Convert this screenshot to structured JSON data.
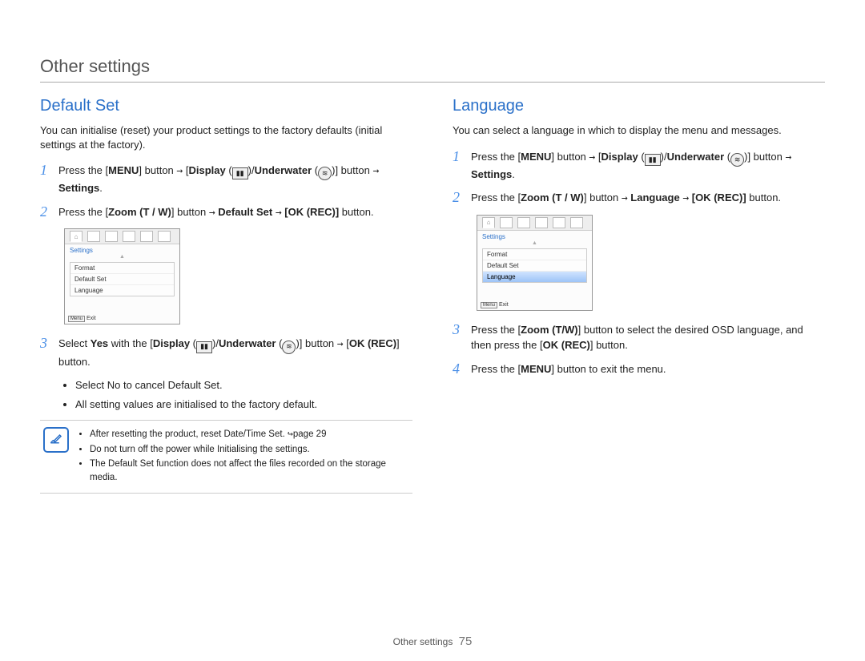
{
  "page": {
    "title": "Other settings",
    "footer_label": "Other settings",
    "footer_page": "75"
  },
  "icons": {
    "display": "▮▮",
    "underwater": "≋",
    "arrow": "→",
    "sub_arrow": "↪"
  },
  "common": {
    "step1_a": "Press the [",
    "step1_menu": "MENU",
    "step1_b": "] button ",
    "step1_c": " [",
    "step1_display": "Display",
    "step1_d": " (",
    "step1_e": ")/",
    "step1_under": "Underwater",
    "step1_f": " (",
    "step1_g": ")]",
    "step1_h": " button ",
    "step1_settings": "Settings",
    "step1_period": ".",
    "step2_a": "Press the [",
    "step2_zoom": "Zoom",
    "step2_tw": " (T / W)",
    "step2_b": "] button ",
    "step2_okrec": "[OK (REC)]",
    "step2_d": " button."
  },
  "left": {
    "title": "Default Set",
    "intro": "You can initialise (reset) your product settings to the factory defaults (initial settings at the factory).",
    "step2_target": "Default Set",
    "screen": {
      "label": "Settings",
      "items": [
        "Format",
        "Default Set",
        "Language"
      ],
      "highlight_index": -1,
      "exit_box": "Menu",
      "exit": "Exit"
    },
    "step3_a": "Select ",
    "step3_yes": "Yes",
    "step3_b": " with the [",
    "step3_display": "Display",
    "step3_c": " (",
    "step3_d": ")/",
    "step3_under": "Underwater",
    "step3_e": " (",
    "step3_f": ")] button ",
    "step3_g": " [",
    "step3_okrec": "OK (REC)",
    "step3_h": "] button.",
    "bullet1_a": "Select ",
    "bullet1_no": "No",
    "bullet1_b": " to cancel ",
    "bullet1_ds": "Default Set",
    "bullet1_c": ".",
    "bullet2": "All setting values are initialised to the factory default.",
    "note1_a": "After resetting the product, reset ",
    "note1_dts": "Date/Time Set",
    "note1_b": ". ",
    "note1_c": "page 29",
    "note2": "Do not turn off the power while Initialising the settings.",
    "note3": "The Default Set function does not affect the files recorded on the storage media."
  },
  "right": {
    "title": "Language",
    "intro": "You can select a language in which to display the menu and messages.",
    "step2_target": "Language",
    "screen": {
      "label": "Settings",
      "items": [
        "Format",
        "Default Set",
        "Language"
      ],
      "highlight_index": 2,
      "exit_box": "Menu",
      "exit": "Exit"
    },
    "step3_a": "Press the [",
    "step3_zoom": "Zoom",
    "step3_tw": " (T/W)",
    "step3_b": "] button to select the desired OSD language, and then press the [",
    "step3_okrec": "OK (REC)",
    "step3_c": "] button.",
    "step4_a": "Press the [",
    "step4_menu": "MENU",
    "step4_b": "] button to exit the menu."
  }
}
